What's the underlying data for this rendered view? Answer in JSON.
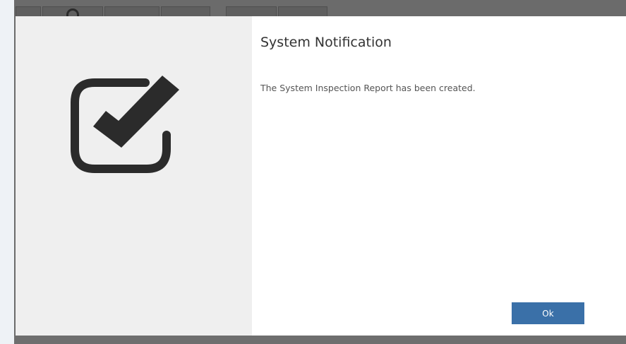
{
  "dialog": {
    "title": "System Notification",
    "message": "The System Inspection Report has been created.",
    "ok_label": "Ok",
    "icon": "checkbox-checked-icon"
  },
  "toolbar": {
    "icons": [
      "toolbar-icon-1",
      "toolbar-icon-2",
      "toolbar-icon-3",
      "toolbar-icon-4",
      "toolbar-icon-5",
      "toolbar-icon-6"
    ]
  },
  "colors": {
    "button": "#3a70a8",
    "left_panel": "#efefef",
    "backdrop": "#6b6b6b",
    "icon": "#2b2b2b"
  }
}
